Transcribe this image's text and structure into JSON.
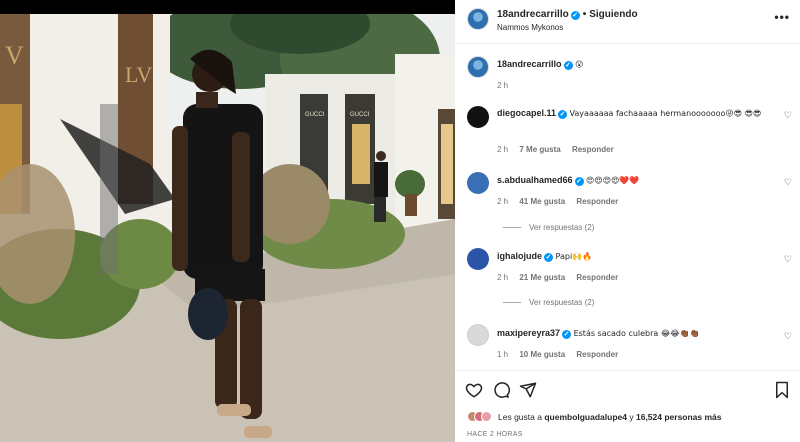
{
  "header": {
    "username": "18andrecarrillo",
    "following_label": "Siguiendo",
    "location": "Nammos Mykonos",
    "more_label": "•••"
  },
  "caption": {
    "username": "18andrecarrillo",
    "text": "😮",
    "time": "2 h"
  },
  "comments": [
    {
      "username": "diegocapel.11",
      "text": "Vayaaaaaa fachaaaaa hermanooooooo😜😎 😎😎",
      "time": "2 h",
      "likes": "7 Me gusta",
      "reply": "Responder",
      "view_replies": "",
      "avatar_color": "#111111"
    },
    {
      "username": "s.abdualhamed66",
      "text": "😍😍😍😍❤️❤️",
      "time": "2 h",
      "likes": "41 Me gusta",
      "reply": "Responder",
      "view_replies": "Ver respuestas (2)",
      "avatar_color": "#3a6fb5"
    },
    {
      "username": "ighalojude",
      "text": "Papi🙌🔥",
      "time": "2 h",
      "likes": "21 Me gusta",
      "reply": "Responder",
      "view_replies": "Ver respuestas (2)",
      "avatar_color": "#2b55a8"
    },
    {
      "username": "maxipereyra37",
      "text": "Estás sacado culebra 😂😂👏🏾👏🏾",
      "time": "1 h",
      "likes": "10 Me gusta",
      "reply": "Responder",
      "view_replies": "",
      "avatar_color": "#d9d9d9"
    }
  ],
  "actions": {
    "likes_prefix": "Les gusta a",
    "likes_user": "quembolguadalupe4",
    "likes_middle": "y",
    "likes_count": "16,524 personas más",
    "time_ago": "HACE 2 HORAS"
  },
  "icons": {
    "like": "heart-icon",
    "comment": "comment-icon",
    "share": "share-icon",
    "save": "bookmark-icon"
  }
}
